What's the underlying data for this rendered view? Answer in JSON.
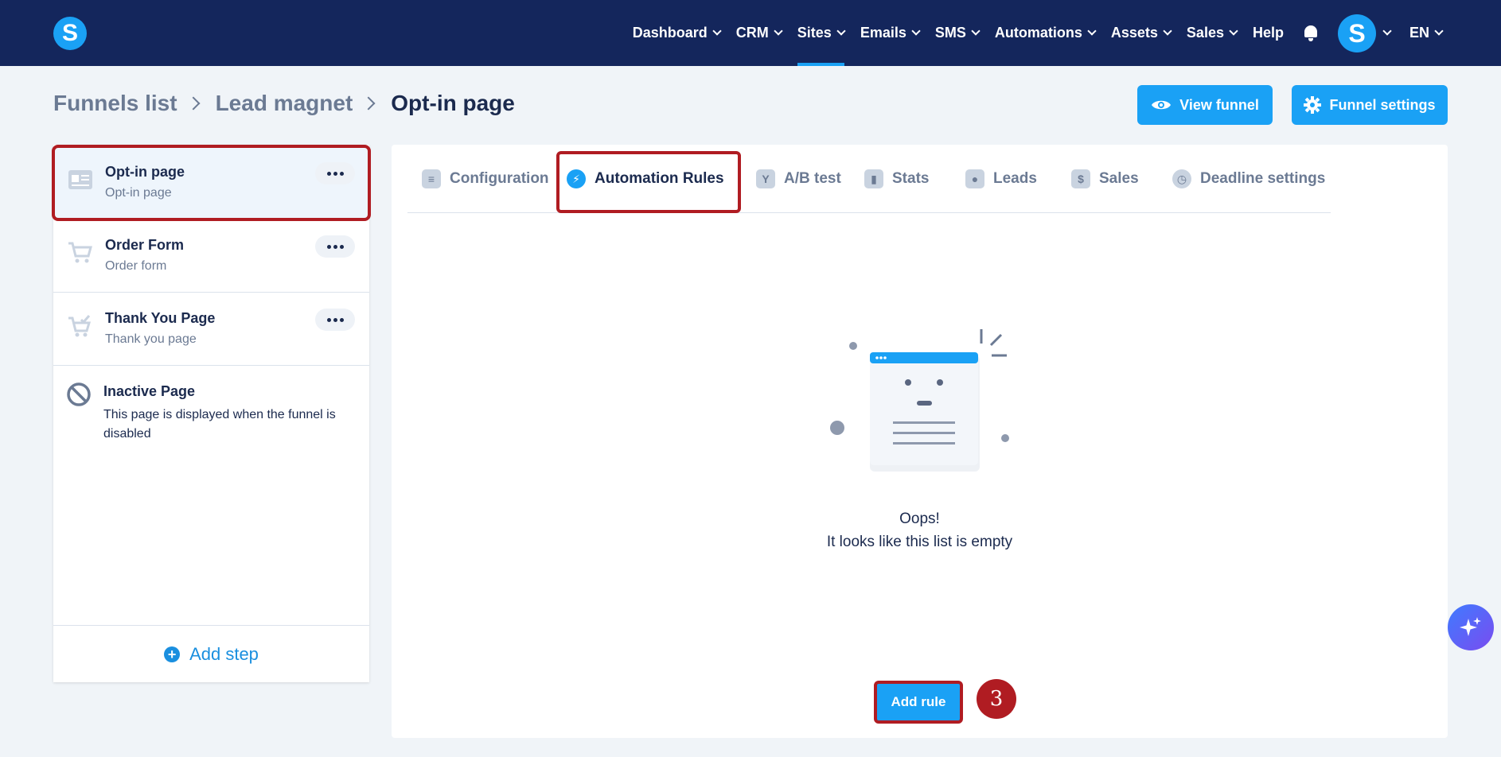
{
  "nav": {
    "items": [
      {
        "label": "Dashboard",
        "dropdown": true
      },
      {
        "label": "CRM",
        "dropdown": true
      },
      {
        "label": "Sites",
        "dropdown": true,
        "active": true
      },
      {
        "label": "Emails",
        "dropdown": true
      },
      {
        "label": "SMS",
        "dropdown": true
      },
      {
        "label": "Automations",
        "dropdown": true
      },
      {
        "label": "Assets",
        "dropdown": true
      },
      {
        "label": "Sales",
        "dropdown": true
      },
      {
        "label": "Help",
        "dropdown": false
      }
    ],
    "logo_letter": "S",
    "avatar_letter": "S",
    "language": "EN"
  },
  "breadcrumb": [
    "Funnels list",
    "Lead magnet",
    "Opt-in page"
  ],
  "header_buttons": {
    "view": "View funnel",
    "settings": "Funnel settings"
  },
  "steps": [
    {
      "title": "Opt-in page",
      "subtitle": "Opt-in page"
    },
    {
      "title": "Order Form",
      "subtitle": "Order form"
    },
    {
      "title": "Thank You Page",
      "subtitle": "Thank you page"
    }
  ],
  "inactive": {
    "title": "Inactive Page",
    "description": "This page is displayed when the funnel is disabled"
  },
  "add_step": "Add step",
  "tabs": [
    "Configuration",
    "Automation Rules",
    "A/B test",
    "Stats",
    "Leads",
    "Sales",
    "Deadline settings"
  ],
  "empty": {
    "line1": "Oops!",
    "line2": "It looks like this list is empty"
  },
  "add_rule": "Add rule",
  "annotation_number": "3",
  "colors": {
    "navy": "#14265c",
    "accent": "#1aa1f5",
    "highlight": "#b01c22"
  }
}
